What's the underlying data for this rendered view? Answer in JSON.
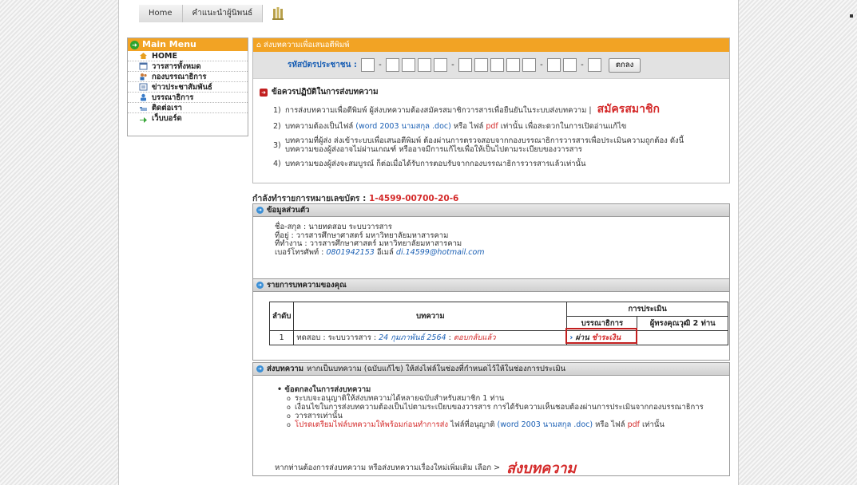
{
  "nav": {
    "home": "Home",
    "guide": "คำแนะนำผู้นิพนธ์"
  },
  "menu": {
    "title": "Main Menu",
    "items": [
      {
        "label": "HOME",
        "icon": "home-icon"
      },
      {
        "label": "วารสารทั้งหมด",
        "icon": "calendar-icon"
      },
      {
        "label": "กองบรรณาธิการ",
        "icon": "people-icon"
      },
      {
        "label": "ข่าวประชาสัมพันธ์",
        "icon": "news-icon"
      },
      {
        "label": "บรรณาธิการ",
        "icon": "person-icon"
      },
      {
        "label": "ติดต่อเรา",
        "icon": "contact-icon"
      },
      {
        "label": "เว็บบอร์ด",
        "icon": "forum-icon"
      }
    ]
  },
  "submit": {
    "header": "ส่งบทความเพื่อเสนอตีพิมพ์",
    "id_label": "รหัสบัตรประชาชน :",
    "ok_button": "ตกลง",
    "rules_title": "ข้อควรปฏิบัติในการส่งบทความ",
    "rules": [
      {
        "num": "1)",
        "text": "การส่งบทความเพื่อตีพิมพ์ ผู้ส่งบทความต้องสมัครสมาชิกวารสารเพื่อยืนยันในระบบส่งบทความ |",
        "link": "สมัครสมาชิก"
      },
      {
        "num": "2)",
        "text_a": "บทความต้องเป็นไฟล์",
        "text_b": "(word 2003 นามสกุล .doc)",
        "text_c": "หรือ ไฟล์",
        "text_d": "pdf",
        "text_e": "เท่านั้น เพื่อสะดวกในการเปิดอ่านแก้ไข"
      },
      {
        "num": "3)",
        "line1": "บทความที่ผู้ส่ง ส่งเข้าระบบเพื่อเสนอตีพิมพ์ ต้องผ่านการตรวจสอบจากกองบรรณาธิการวารสารเพื่อประเมินความถูกต้อง ดังนี้",
        "line2": "บทความของผู้ส่งอาจไม่ผ่านเกณฑ์ หรืออาจมีการแก้ไขเพื่อให้เป็นไปตามระเบียบของวารสาร"
      },
      {
        "num": "4)",
        "text": "บทความของผู้ส่งจะสมบูรณ์ ก็ต่อเมื่อได้รับการตอบรับจากกองบรรณาธิการวารสารแล้วเท่านั้น"
      }
    ]
  },
  "processing": {
    "label": "กำลังทำรายการหมายเลขบัตร :",
    "code": "1-4599-00700-20-6"
  },
  "personal": {
    "header": "ข้อมูลส่วนตัว",
    "name": "ชื่อ-สกุล : นายทดสอบ ระบบวารสาร",
    "address": "ที่อยู่ : วารสารศึกษาศาสตร์ มหาวิทยาลัยมหาสารคาม",
    "workplace": "ที่ทำงาน : วารสารศึกษาศาสตร์ มหาวิทยาลัยมหาสารคาม",
    "phone_label": "เบอร์โทรศัพท์ :",
    "phone": "0801942153",
    "email_label": "อีเมล์",
    "email": "di.14599@hotmail.com"
  },
  "articles": {
    "header": "รายการบทความของคุณ",
    "col_no": "ลำดับ",
    "col_article": "บทความ",
    "col_eval": "การประเมิน",
    "col_editor": "บรรณาธิการ",
    "col_experts": "ผู้ทรงคุณวุฒิ 2 ท่าน",
    "rows": [
      {
        "no": "1",
        "title": "ทดสอบ : ระบบวารสาร :",
        "date": "24 กุมภาพันธ์ 2564",
        "status": "ตอบกลับแล้ว",
        "pass": "ผ่าน",
        "pay": "ชำระเงิน"
      }
    ]
  },
  "send": {
    "header": "ส่งบทความ",
    "header_desc": "หากเป็นบทความ (ฉบับแก้ไข) ให้ส่งไฟล์ในช่องที่กำหนดไว้ให้ในช่องการประเมิน",
    "terms_title": "ข้อตกลงในการส่งบทความ",
    "terms": [
      "ระบบจะอนุญาติให้ส่งบทความได้หลายฉบับสำหรับสมาชิก 1 ท่าน",
      "เงื่อนไขในการส่งบทความต้องเป็นไปตามระเบียบของวารสาร การได้รับความเห็นชอบต้องผ่านการประเมินจากกองบรรณาธิการ",
      "วารสารเท่านั้น"
    ],
    "term_red": "โปรดเตรียมไฟล์บทความให้พร้อมก่อนทำการส่ง",
    "term_red_b": "ไฟล์ที่อนุญาติ",
    "term_blue": "(word 2003 นามสกุล .doc)",
    "term_or": "หรือ ไฟล์",
    "term_pdf": "pdf",
    "term_only": "เท่านั้น",
    "final_text": "หากท่านต้องการส่งบทความ หรือส่งบทความเรื่องใหม่เพิ่มเติม เลือก >",
    "final_link": "ส่งบทความ"
  }
}
